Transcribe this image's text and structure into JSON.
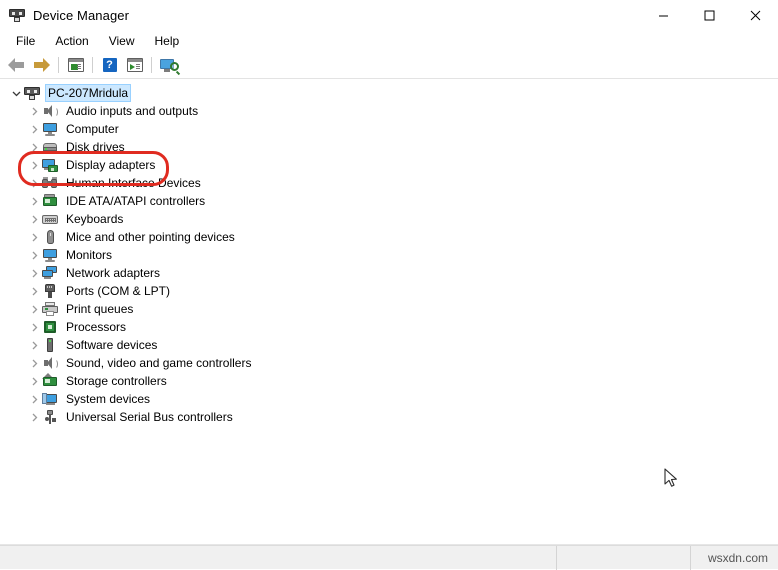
{
  "window": {
    "title": "Device Manager",
    "icon": "device-manager-icon",
    "controls": {
      "minimize": "minimize-icon",
      "maximize": "maximize-icon",
      "close": "close-icon"
    }
  },
  "menubar": {
    "items": [
      {
        "label": "File"
      },
      {
        "label": "Action"
      },
      {
        "label": "View"
      },
      {
        "label": "Help"
      }
    ]
  },
  "toolbar": {
    "buttons": [
      {
        "name": "back-button",
        "icon": "back-arrow-icon"
      },
      {
        "name": "forward-button",
        "icon": "forward-arrow-icon"
      },
      {
        "name": "properties-button",
        "icon": "properties-window-icon"
      },
      {
        "name": "help-button",
        "icon": "help-question-icon"
      },
      {
        "name": "update-driver-button",
        "icon": "update-driver-window-icon"
      },
      {
        "name": "scan-hardware-button",
        "icon": "scan-for-hardware-changes-icon"
      }
    ]
  },
  "tree": {
    "root": {
      "label": "PC-207Mridula",
      "icon": "computer-icon",
      "expanded": true,
      "selected": true
    },
    "items": [
      {
        "label": "Audio inputs and outputs",
        "icon": "speaker-icon"
      },
      {
        "label": "Computer",
        "icon": "monitor-icon"
      },
      {
        "label": "Disk drives",
        "icon": "disk-drive-icon"
      },
      {
        "label": "Display adapters",
        "icon": "display-adapter-icon",
        "highlighted": true
      },
      {
        "label": "Human Interface Devices",
        "icon": "hid-icon"
      },
      {
        "label": "IDE ATA/ATAPI controllers",
        "icon": "ide-controller-icon"
      },
      {
        "label": "Keyboards",
        "icon": "keyboard-icon"
      },
      {
        "label": "Mice and other pointing devices",
        "icon": "mouse-icon"
      },
      {
        "label": "Monitors",
        "icon": "monitor-icon"
      },
      {
        "label": "Network adapters",
        "icon": "network-adapter-icon"
      },
      {
        "label": "Ports (COM & LPT)",
        "icon": "port-icon"
      },
      {
        "label": "Print queues",
        "icon": "printer-icon"
      },
      {
        "label": "Processors",
        "icon": "processor-icon"
      },
      {
        "label": "Software devices",
        "icon": "software-device-icon"
      },
      {
        "label": "Sound, video and game controllers",
        "icon": "speaker-icon"
      },
      {
        "label": "Storage controllers",
        "icon": "storage-controller-icon"
      },
      {
        "label": "System devices",
        "icon": "system-device-icon"
      },
      {
        "label": "Universal Serial Bus controllers",
        "icon": "usb-icon"
      }
    ]
  },
  "annotation": {
    "highlight_color": "#e02b20",
    "target": "Display adapters"
  },
  "statusbar": {
    "pane1": "",
    "pane2": "",
    "watermark": "wsxdn.com"
  },
  "colors": {
    "selection": "#cce8ff",
    "accent_blue": "#3e9fe0",
    "accent_green": "#2f8f3f",
    "highlight_red": "#e02b20",
    "statusbar_bg": "#f0f0f0"
  }
}
